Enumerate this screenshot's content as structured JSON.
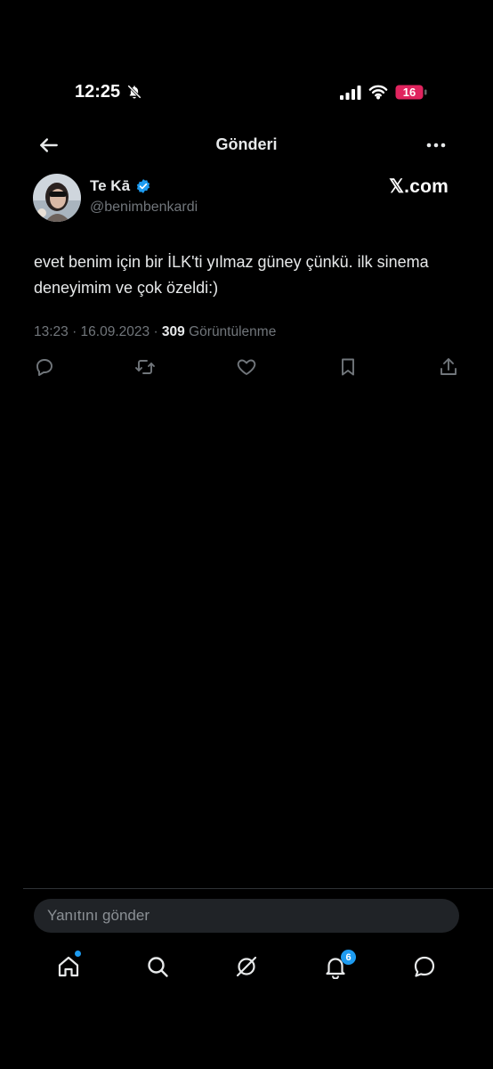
{
  "status_bar": {
    "time": "12:25",
    "battery": "16",
    "icons": [
      "bell-slash-icon",
      "signal-icon",
      "wifi-icon",
      "battery-icon"
    ]
  },
  "header": {
    "title": "Gönderi",
    "back_icon": "arrow-left-icon",
    "more_icon": "more-horizontal-icon"
  },
  "post": {
    "author_name": "Te Kā",
    "handle": "@benimbenkardi",
    "verified": true,
    "watermark": "𝕏.com",
    "text": "evet benim için bir İLK'ti yılmaz güney çünkü. ilk sinema deneyimim ve çok özeldi:)",
    "timestamp": "13:23 · 16.09.2023 · ",
    "views_count": "309",
    "views_label": " Görüntülenme",
    "actions": [
      "reply-icon",
      "retweet-icon",
      "like-icon",
      "bookmark-icon",
      "share-icon"
    ]
  },
  "compose": {
    "placeholder": "Yanıtını gönder"
  },
  "bottom_nav": {
    "items": [
      "home-icon",
      "search-icon",
      "grok-icon",
      "notifications-icon",
      "messages-icon"
    ],
    "notification_badge": "6"
  },
  "colors": {
    "background": "#000000",
    "text": "#e7e9ea",
    "secondary_text": "#71767b",
    "accent": "#1d9bf0",
    "battery_low": "#e0245e"
  }
}
